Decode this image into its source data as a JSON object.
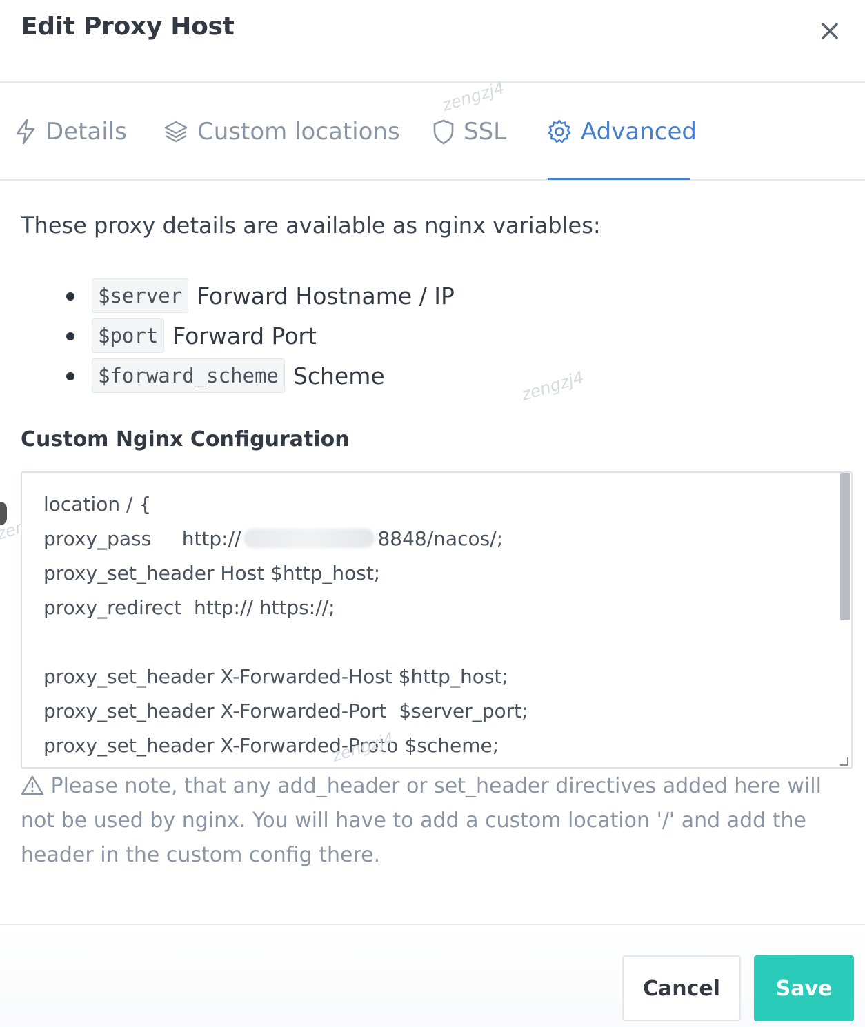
{
  "modal": {
    "title": "Edit Proxy Host"
  },
  "tabs": [
    {
      "label": "Details",
      "icon": "lightning-icon",
      "active": false
    },
    {
      "label": "Custom locations",
      "icon": "layers-icon",
      "active": false
    },
    {
      "label": "SSL",
      "icon": "shield-icon",
      "active": false
    },
    {
      "label": "Advanced",
      "icon": "gear-icon",
      "active": true
    }
  ],
  "watermarks": [
    "zengzj4",
    "zengzj4",
    "zengzj4",
    "zengzj4"
  ],
  "intro": "These proxy details are available as nginx variables:",
  "variables": [
    {
      "code": "$server",
      "desc": "Forward Hostname / IP"
    },
    {
      "code": "$port",
      "desc": "Forward Port"
    },
    {
      "code": "$forward_scheme",
      "desc": "Scheme"
    }
  ],
  "config_label": "Custom Nginx Configuration",
  "config": {
    "lines": [
      "location / {",
      "proxy_pass     http://",
      "proxy_set_header Host $http_host;",
      "proxy_redirect  http:// https://;",
      "",
      "proxy_set_header X-Forwarded-Host $http_host;",
      "proxy_set_header X-Forwarded-Port  $server_port;",
      "proxy_set_header X-Forwarded-Proto $scheme;"
    ],
    "proxy_pass_suffix": "8848/nacos/;"
  },
  "note": "Please note, that any add_header or set_header directives added here will not be used by nginx. You will have to add a custom location '/' and add the header in the custom config there.",
  "buttons": {
    "cancel": "Cancel",
    "save": "Save"
  },
  "colors": {
    "accent": "#467fcf",
    "save": "#2bcbba",
    "muted": "#8a94a3"
  }
}
